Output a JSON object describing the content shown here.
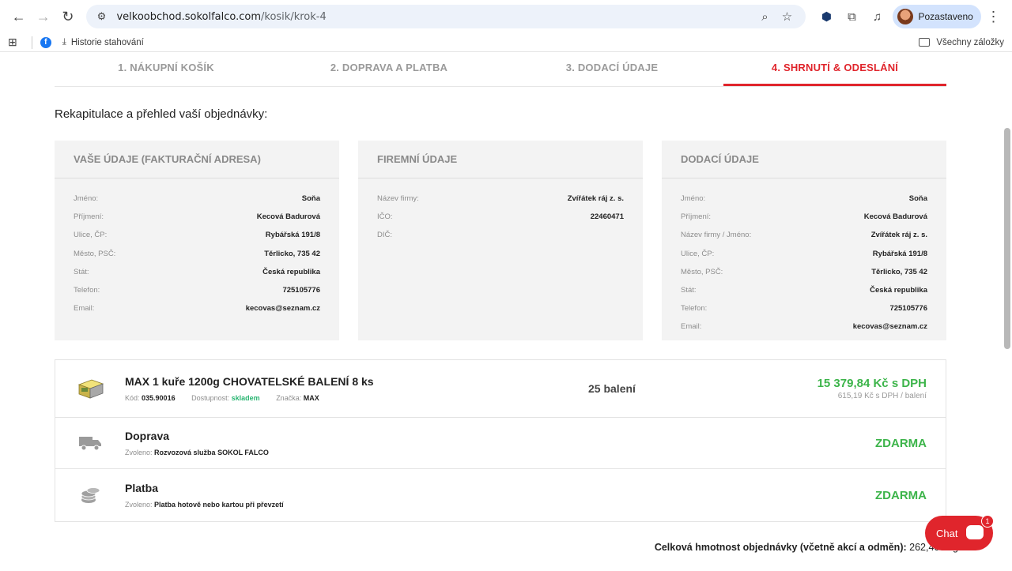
{
  "browser": {
    "url_host": "velkoobchod.sokolfalco.com",
    "url_path": "/kosik/krok-4",
    "profile_label": "Pozastaveno",
    "bookmarks": [
      {
        "label": "",
        "icon": "facebook-icon"
      },
      {
        "label": "Historie stahování",
        "icon": "download-icon"
      }
    ],
    "all_bookmarks_label": "Všechny záložky"
  },
  "steps": [
    {
      "label": "1. NÁKUPNÍ KOŠÍK"
    },
    {
      "label": "2. DOPRAVA A PLATBA"
    },
    {
      "label": "3. DODACÍ ÚDAJE"
    },
    {
      "label": "4. SHRNUTÍ & ODESLÁNÍ"
    }
  ],
  "recap_title": "Rekapitulace a přehled vaší objednávky:",
  "cards": {
    "billing": {
      "title": "VAŠE ÚDAJE (FAKTURAČNÍ ADRESA)",
      "rows": [
        {
          "label": "Jméno:",
          "value": "Soňa"
        },
        {
          "label": "Příjmení:",
          "value": "Kecová Badurová"
        },
        {
          "label": "Ulice, ČP:",
          "value": "Rybářská 191/8"
        },
        {
          "label": "Město, PSČ:",
          "value": "Těrlicko, 735 42"
        },
        {
          "label": "Stát:",
          "value": "Česká republika"
        },
        {
          "label": "Telefon:",
          "value": "725105776"
        },
        {
          "label": "Email:",
          "value": "kecovas@seznam.cz"
        }
      ]
    },
    "company": {
      "title": "FIREMNÍ ÚDAJE",
      "rows": [
        {
          "label": "Název firmy:",
          "value": "Zvířátek ráj z. s."
        },
        {
          "label": "IČO:",
          "value": "22460471"
        },
        {
          "label": "DIČ:",
          "value": ""
        }
      ]
    },
    "delivery": {
      "title": "DODACÍ ÚDAJE",
      "rows": [
        {
          "label": "Jméno:",
          "value": "Soňa"
        },
        {
          "label": "Příjmení:",
          "value": "Kecová Badurová"
        },
        {
          "label": "Název firmy / Jméno:",
          "value": "Zvířátek ráj z. s."
        },
        {
          "label": "Ulice, ČP:",
          "value": "Rybářská 191/8"
        },
        {
          "label": "Město, PSČ:",
          "value": "Těrlicko, 735 42"
        },
        {
          "label": "Stát:",
          "value": "Česká republika"
        },
        {
          "label": "Telefon:",
          "value": "725105776"
        },
        {
          "label": "Email:",
          "value": "kecovas@seznam.cz"
        }
      ]
    }
  },
  "product": {
    "name": "MAX 1 kuře 1200g CHOVATELSKÉ BALENÍ 8 ks",
    "code_label": "Kód:",
    "code": "035.90016",
    "availability_label": "Dostupnost:",
    "availability": "skladem",
    "brand_label": "Značka:",
    "brand": "MAX",
    "quantity": "25 balení",
    "price": "15 379,84 Kč s DPH",
    "unit_price": "615,19 Kč s DPH / balení"
  },
  "shipping": {
    "title": "Doprava",
    "chosen_label": "Zvoleno:",
    "chosen": "Rozvozová služba SOKOL FALCO",
    "price": "ZDARMA"
  },
  "payment": {
    "title": "Platba",
    "chosen_label": "Zvoleno:",
    "chosen": "Platba hotově nebo kartou při převzetí",
    "price": "ZDARMA"
  },
  "total_weight": {
    "label": "Celková hmotnost objednávky (včetně akcí a odměn):",
    "value": "262,400 kg"
  },
  "chat": {
    "label": "Chat",
    "badge": "1"
  },
  "colors": {
    "accent": "#e0252c",
    "price_green": "#3cb44a",
    "card_bg": "#f3f3f3"
  }
}
